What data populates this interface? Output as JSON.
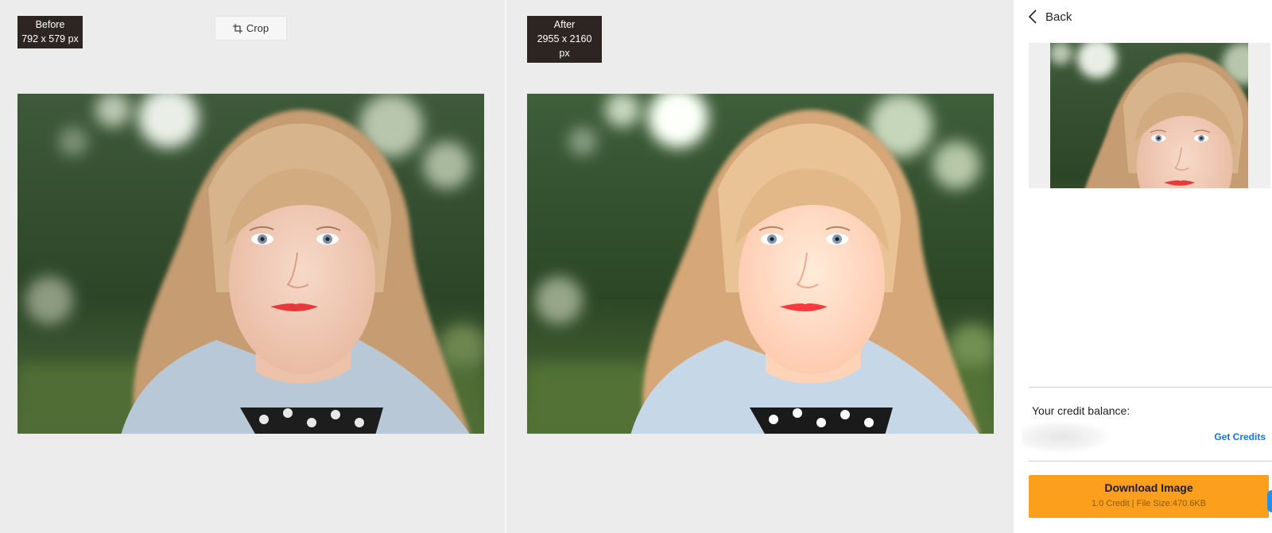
{
  "before": {
    "label": "Before",
    "dimensions": "792 x 579 px",
    "crop_label": "Crop",
    "crop_icon": "crop-icon"
  },
  "after": {
    "label": "After",
    "dimensions": "2955 x 2160 px"
  },
  "sidebar": {
    "back_label": "Back",
    "back_icon": "chevron-left-icon",
    "credit_label": "Your credit balance:",
    "get_credits_label": "Get Credits",
    "download_label": "Download Image",
    "download_sub": "1.0 Credit | File Size:470.6KB"
  },
  "colors": {
    "accent": "#fb9f1c",
    "link": "#1e6fe0",
    "badge_bg": "#2d2522"
  }
}
